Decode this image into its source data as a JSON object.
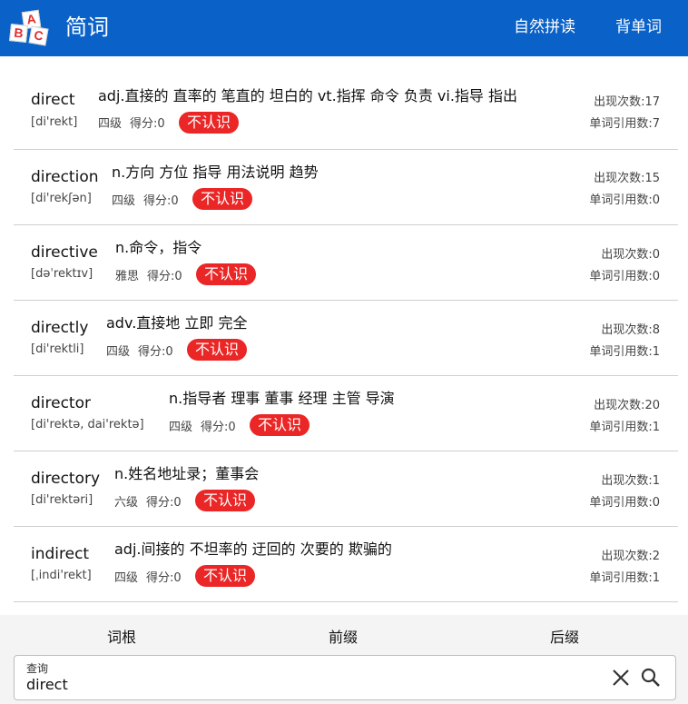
{
  "header": {
    "title": "简词",
    "logo_letters": [
      "A",
      "B",
      "C"
    ],
    "nav": [
      {
        "label": "自然拼读"
      },
      {
        "label": "背单词"
      }
    ]
  },
  "words": [
    {
      "word": "direct",
      "phonetic": "[di'rekt]",
      "definition": "adj.直接的 直率的 笔直的 坦白的 vt.指挥 命令 负责 vi.指导 指出",
      "level": "四级",
      "score": "得分:0",
      "status": "不认识",
      "occurrences": "出现次数:17",
      "citations": "单词引用数:7"
    },
    {
      "word": "direction",
      "phonetic": "[di'rekʃən]",
      "definition": "n.方向 方位 指导 用法说明 趋势",
      "level": "四级",
      "score": "得分:0",
      "status": "不认识",
      "occurrences": "出现次数:15",
      "citations": "单词引用数:0"
    },
    {
      "word": "directive",
      "phonetic": "[dəˈrektɪv]",
      "definition": "n.命令，指令",
      "level": "雅思",
      "score": "得分:0",
      "status": "不认识",
      "occurrences": "出现次数:0",
      "citations": "单词引用数:0"
    },
    {
      "word": "directly",
      "phonetic": "[di'rektli]",
      "definition": "adv.直接地 立即 完全",
      "level": "四级",
      "score": "得分:0",
      "status": "不认识",
      "occurrences": "出现次数:8",
      "citations": "单词引用数:1"
    },
    {
      "word": "director",
      "phonetic": "[di'rektə, dai'rektə]",
      "definition": "n.指导者 理事 董事 经理 主管 导演",
      "level": "四级",
      "score": "得分:0",
      "status": "不认识",
      "occurrences": "出现次数:20",
      "citations": "单词引用数:1"
    },
    {
      "word": "directory",
      "phonetic": "[di'rektəri]",
      "definition": "n.姓名地址录；董事会",
      "level": "六级",
      "score": "得分:0",
      "status": "不认识",
      "occurrences": "出现次数:1",
      "citations": "单词引用数:0"
    },
    {
      "word": "indirect",
      "phonetic": "[ˌindi'rekt]",
      "definition": "adj.间接的 不坦率的 迂回的 次要的 欺骗的",
      "level": "四级",
      "score": "得分:0",
      "status": "不认识",
      "occurrences": "出现次数:2",
      "citations": "单词引用数:1"
    }
  ],
  "bottom_tabs": [
    {
      "label": "词根"
    },
    {
      "label": "前缀"
    },
    {
      "label": "后缀"
    }
  ],
  "search": {
    "label": "查询",
    "value": "direct"
  },
  "colors": {
    "header_bg": "#0a61c8",
    "badge_bg": "#ea2626",
    "divider": "#cfcfcf"
  },
  "icons": [
    "logo-abc-blocks-icon",
    "clear-icon",
    "search-icon"
  ]
}
